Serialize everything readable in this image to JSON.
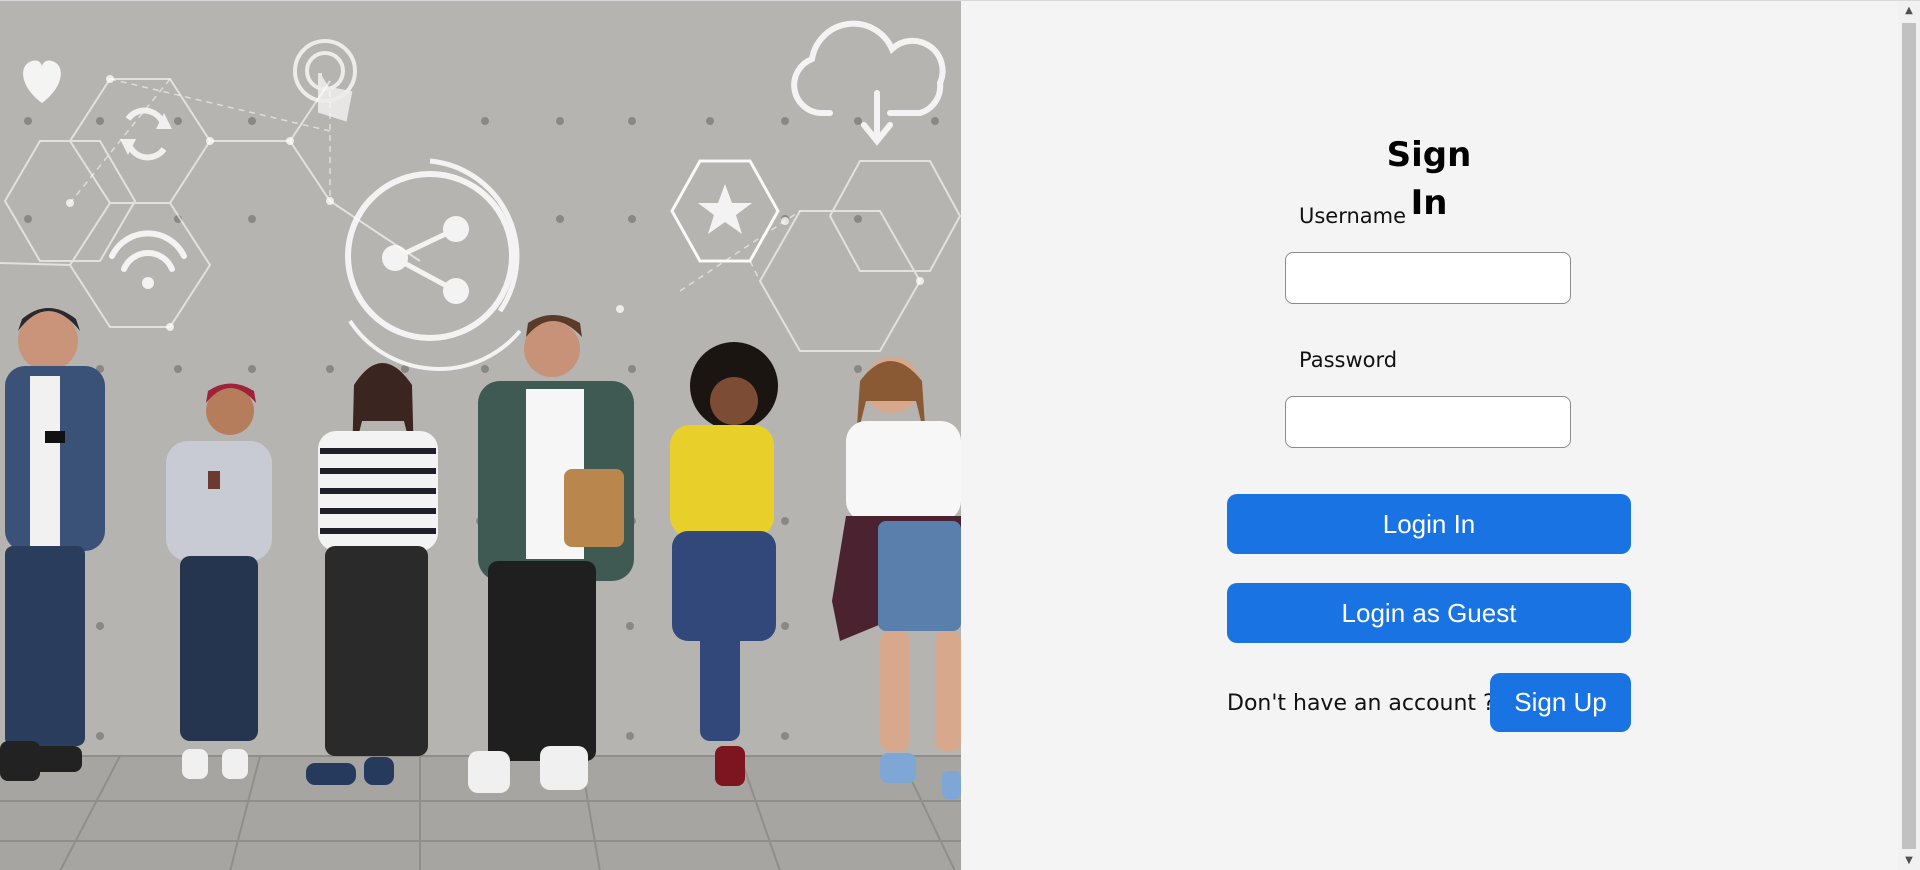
{
  "hero": {
    "image_name": "people-with-phones-against-concrete-wall",
    "icons": [
      "heart-icon",
      "refresh-icon",
      "touch-icon",
      "share-icon",
      "wifi-icon",
      "cloud-download-icon",
      "star-icon"
    ]
  },
  "form": {
    "title": "Sign In",
    "username_label": "Username",
    "username_value": "",
    "password_label": "Password",
    "password_value": "",
    "login_button": "Login In",
    "guest_button": "Login as Guest",
    "signup_prompt": "Don't have an account ?",
    "signup_button": "Sign Up"
  },
  "colors": {
    "accent": "#1a73e3",
    "panel_bg": "#f4f4f4",
    "wall": "#b3b2ae"
  }
}
